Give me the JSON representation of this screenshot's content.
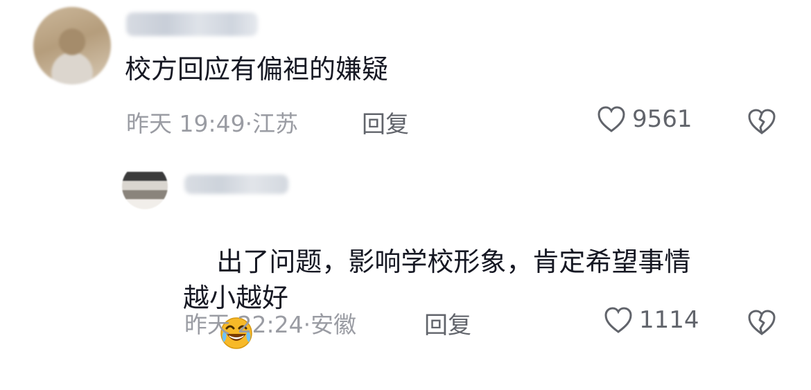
{
  "comments": [
    {
      "text": "校方回应有偏袒的嫌疑",
      "meta": "昨天 19:49·江苏",
      "reply_label": "回复",
      "likes": "9561",
      "icons": {
        "avatar": "blurred-avatar",
        "like": "heart-icon",
        "dislike": "broken-heart-icon"
      }
    },
    {
      "text": "出了问题，影响学校形象，肯定希望事情\n越小越好",
      "emoji": "crying-laughing-emoji",
      "meta": "昨天 22:24·安徽",
      "reply_label": "回复",
      "likes": "1114",
      "icons": {
        "avatar": "blurred-avatar",
        "like": "heart-icon",
        "dislike": "broken-heart-icon"
      }
    }
  ],
  "colors": {
    "text": "#161823",
    "meta": "#9a9ca3",
    "action": "#61646b",
    "background": "#ffffff"
  }
}
